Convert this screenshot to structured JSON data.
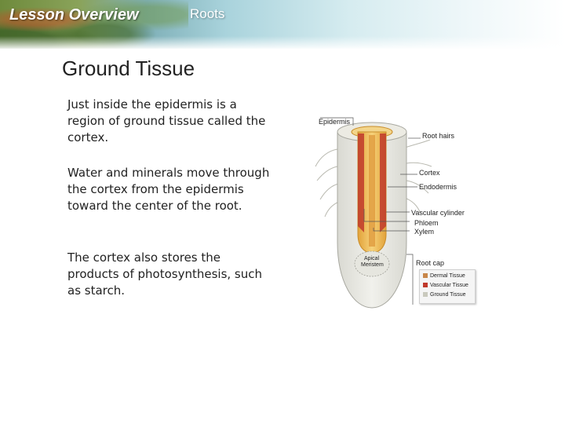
{
  "header": {
    "lesson_label": "Lesson Overview",
    "topic": "Roots"
  },
  "slide": {
    "title": "Ground Tissue",
    "paragraphs": [
      "Just inside the epidermis is a region of ground tissue called the cortex.",
      "Water and minerals move through the cortex from the epidermis toward the center of the root.",
      "The cortex also stores the products of photosynthesis, such as starch."
    ]
  },
  "figure": {
    "labels": {
      "epidermis": "Epidermis",
      "root_hairs": "Root hairs",
      "cortex": "Cortex",
      "endodermis": "Endodermis",
      "vascular_cylinder": "Vascular cylinder",
      "phloem": "Phloem",
      "xylem": "Xylem",
      "apical_meristem_line1": "Apical",
      "apical_meristem_line2": "Meristem",
      "root_cap": "Root cap"
    },
    "legend": [
      {
        "label": "Dermal Tissue",
        "color": "#c8874a"
      },
      {
        "label": "Vascular Tissue",
        "color": "#c0392b"
      },
      {
        "label": "Ground Tissue",
        "color": "#c9c9bd"
      }
    ]
  }
}
